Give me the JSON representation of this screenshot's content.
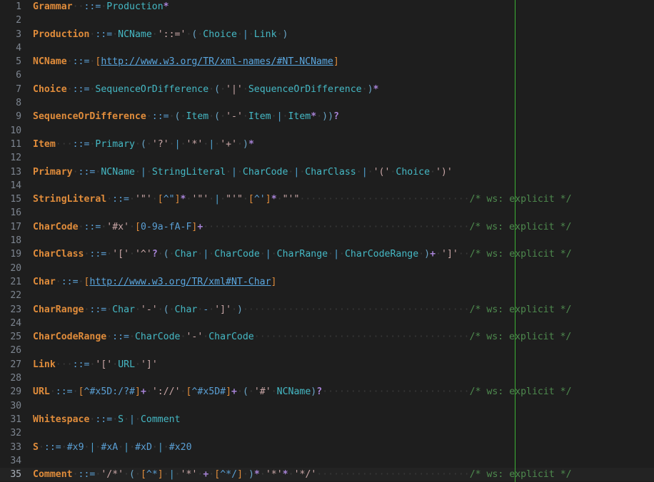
{
  "editor": {
    "name": "ebnf-grammar-editor",
    "background": "#1e1e1e",
    "ruler_color": "#3cb034",
    "ruler_column": 78,
    "active_line": 35,
    "total_lines": 35,
    "trailing_comment": "/* ws: explicit */"
  },
  "colors": {
    "rule_name": "#e08c3b",
    "nonterminal": "#45b8c4",
    "operator": "#5a9fd4",
    "string": "#c9a6a6",
    "quantifier": "#a884d8",
    "comment": "#4e8a4e",
    "url": "#5aa7e0",
    "gutter": "#7d8590",
    "whitespace_dot": "#3b3b3b"
  },
  "gutter": {
    "numbers": [
      1,
      2,
      3,
      4,
      5,
      6,
      7,
      8,
      9,
      10,
      11,
      12,
      13,
      14,
      15,
      16,
      17,
      18,
      19,
      20,
      21,
      22,
      23,
      24,
      25,
      26,
      27,
      28,
      29,
      30,
      31,
      32,
      33,
      34,
      35
    ]
  },
  "lines": [
    {
      "n": 1,
      "text": "Grammar  ::= Production*"
    },
    {
      "n": 2,
      "text": ""
    },
    {
      "n": 3,
      "text": "Production ::= NCName '::=' ( Choice | Link )"
    },
    {
      "n": 4,
      "text": ""
    },
    {
      "n": 5,
      "text": "NCName ::= [http://www.w3.org/TR/xml-names/#NT-NCName]"
    },
    {
      "n": 6,
      "text": ""
    },
    {
      "n": 7,
      "text": "Choice ::= SequenceOrDifference ( '|' SequenceOrDifference )*"
    },
    {
      "n": 8,
      "text": ""
    },
    {
      "n": 9,
      "text": "SequenceOrDifference ::= ( Item ( '-' Item | Item* ))?"
    },
    {
      "n": 10,
      "text": ""
    },
    {
      "n": 11,
      "text": "Item   ::= Primary ( '?' | '*' | '+' )*"
    },
    {
      "n": 12,
      "text": ""
    },
    {
      "n": 13,
      "text": "Primary ::= NCName | StringLiteral | CharCode | CharClass | '(' Choice ')'"
    },
    {
      "n": 14,
      "text": ""
    },
    {
      "n": 15,
      "text": "StringLiteral ::= '\"' [^\"]* '\"' | \"'\" [^']* \"'\"",
      "comment": "/* ws: explicit */"
    },
    {
      "n": 16,
      "text": ""
    },
    {
      "n": 17,
      "text": "CharCode ::= '#x' [0-9a-fA-F]+",
      "comment": "/* ws: explicit */"
    },
    {
      "n": 18,
      "text": ""
    },
    {
      "n": 19,
      "text": "CharClass ::= '[' '^'? ( Char | CharCode | CharRange | CharCodeRange )+ ']'",
      "comment": "/* ws: explicit */"
    },
    {
      "n": 20,
      "text": ""
    },
    {
      "n": 21,
      "text": "Char ::= [http://www.w3.org/TR/xml#NT-Char]"
    },
    {
      "n": 22,
      "text": ""
    },
    {
      "n": 23,
      "text": "CharRange ::= Char '-' ( Char - ']' )",
      "comment": "/* ws: explicit */"
    },
    {
      "n": 24,
      "text": ""
    },
    {
      "n": 25,
      "text": "CharCodeRange ::= CharCode '-' CharCode",
      "comment": "/* ws: explicit */"
    },
    {
      "n": 26,
      "text": ""
    },
    {
      "n": 27,
      "text": "Link   ::= '[' URL ']'"
    },
    {
      "n": 28,
      "text": ""
    },
    {
      "n": 29,
      "text": "URL ::= [^#x5D:/?#]+ '://' [^#x5D#]+ ( '#' NCName)?",
      "comment": "/* ws: explicit */"
    },
    {
      "n": 30,
      "text": ""
    },
    {
      "n": 31,
      "text": "Whitespace ::= S | Comment"
    },
    {
      "n": 32,
      "text": ""
    },
    {
      "n": 33,
      "text": "S ::= #x9 | #xA | #xD | #x20"
    },
    {
      "n": 34,
      "text": ""
    },
    {
      "n": 35,
      "text": "Comment ::= '/*' ( [^*] | '*' + [^*/] )* '*'* '*/'",
      "comment": "/* ws: explicit */"
    }
  ],
  "urls": {
    "ncname": "http://www.w3.org/TR/xml-names/#NT-NCName",
    "char": "http://www.w3.org/TR/xml#NT-Char"
  }
}
